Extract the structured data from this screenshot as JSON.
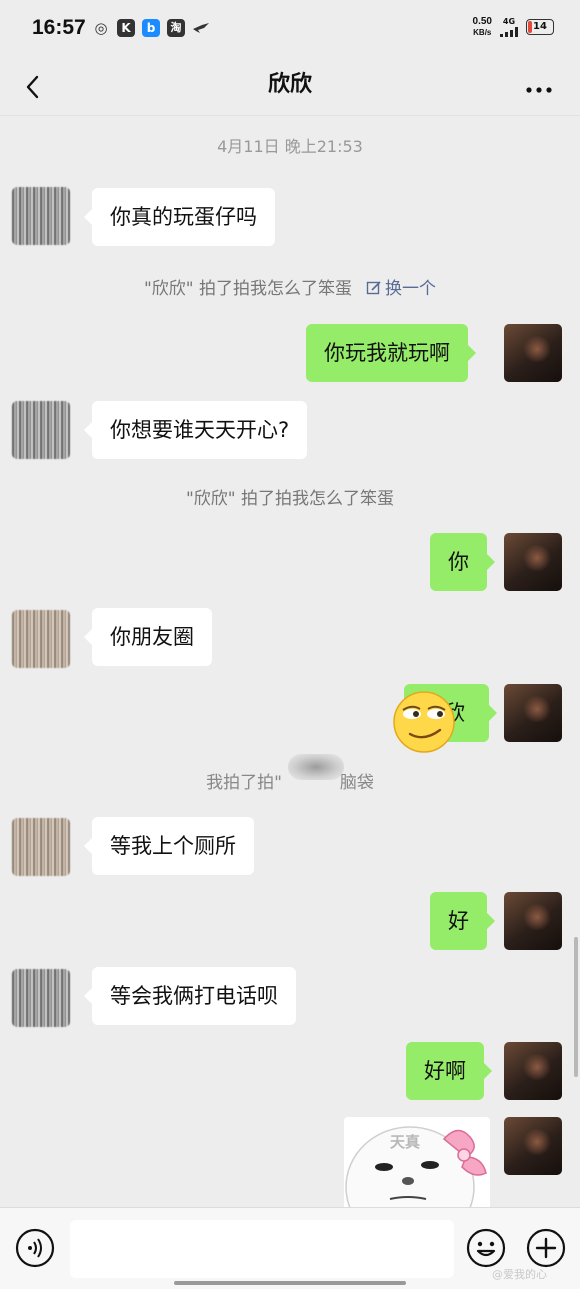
{
  "status_bar": {
    "time": "16:57",
    "app_icons": [
      {
        "name": "weibo-icon",
        "glyph": "◎",
        "color": "#333333"
      },
      {
        "name": "kuaishou-icon",
        "glyph": "K",
        "color": "#333333"
      },
      {
        "name": "bilibili-icon",
        "glyph": "b",
        "color": "#1a8cff"
      },
      {
        "name": "taobao-icon",
        "glyph": "淘",
        "color": "#333333"
      }
    ],
    "speed_value": "0.50",
    "speed_unit": "KB/s",
    "network": "4G",
    "battery": "14",
    "battery_level": 0.14,
    "battery_color": "#e24b3c"
  },
  "header": {
    "title": "欣欣"
  },
  "chat": {
    "timestamp": "4月11日 晚上21:53",
    "messages": [
      {
        "side": "left",
        "text": "你真的玩蛋仔吗"
      },
      {
        "side": "system",
        "text": "\"欣欣\" 拍了拍我怎么了笨蛋",
        "link": "换一个"
      },
      {
        "side": "right",
        "text": "你玩我就玩啊"
      },
      {
        "side": "left",
        "text": "你想要谁天天开心?"
      },
      {
        "side": "system",
        "text": "\"欣欣\" 拍了拍我怎么了笨蛋"
      },
      {
        "side": "right",
        "text": "你"
      },
      {
        "side": "left",
        "text": "你朋友圈"
      },
      {
        "side": "right",
        "text": "欣"
      },
      {
        "side": "system",
        "text_before": "我拍了拍\"",
        "text_after": "脑袋"
      },
      {
        "side": "left",
        "text": "等我上个厕所"
      },
      {
        "side": "right",
        "text": "好"
      },
      {
        "side": "left",
        "text": "等会我俩打电话呗"
      },
      {
        "side": "right",
        "text": "好啊"
      },
      {
        "side": "right",
        "sticker_text": "天真"
      }
    ]
  },
  "input_bar": {
    "placeholder": ""
  },
  "watermark": "@爱我的心",
  "colors": {
    "background": "#ededed",
    "bubble_self": "#95ec69",
    "bubble_other": "#ffffff",
    "link": "#576b95"
  }
}
